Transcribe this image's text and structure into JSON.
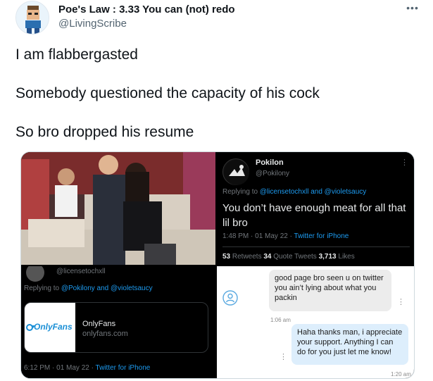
{
  "author": {
    "display_name": "Poe's Law : 3.33 You can (not) redo",
    "handle": "@LivingScribe"
  },
  "tweet": {
    "lines": [
      "I am flabbergasted",
      "Somebody questioned the capacity of his cock",
      "So bro dropped his resume"
    ]
  },
  "media": {
    "quoted_tweet": {
      "name": "Pokilon",
      "handle": "@Pokilony",
      "replying_prefix": "Replying to ",
      "replying_mentions": "@licensetochxll and @violetsaucy",
      "text": "You don’t have enough meat for all that lil bro",
      "time": "1:48 PM · 01 May 22 · ",
      "source": "Twitter for iPhone",
      "retweets": "53",
      "retweets_label": " Retweets  ",
      "quote_tweets": "34",
      "quote_tweets_label": " Quote Tweets  ",
      "likes": "3,713",
      "likes_label": " Likes"
    },
    "reply_tweet": {
      "handle": "@licensetochxll",
      "replying_prefix": "Replying to ",
      "replying_mentions": "@Pokilony and @violetsaucy",
      "card_logo": "OnlyFans",
      "card_title": "OnlyFans",
      "card_domain": "onlyfans.com",
      "time": "6:12 PM · 01 May 22 · ",
      "source": "Twitter for iPhone"
    },
    "chat": {
      "incoming": "good page bro seen u on twitter you ain’t lying about what you packin",
      "incoming_time": "1:06 am",
      "outgoing": "Haha thanks man, i appreciate your support. Anything I can do for you just let me know!",
      "outgoing_time": "1:20 am ✓"
    }
  },
  "colors": {
    "accent": "#1d9bf0",
    "text": "#0f1419",
    "secondary": "#536471",
    "dark_bg": "#000000"
  },
  "icons": [
    "more-icon",
    "person-icon",
    "pokilon-avatar",
    "onlyfans-logo"
  ]
}
